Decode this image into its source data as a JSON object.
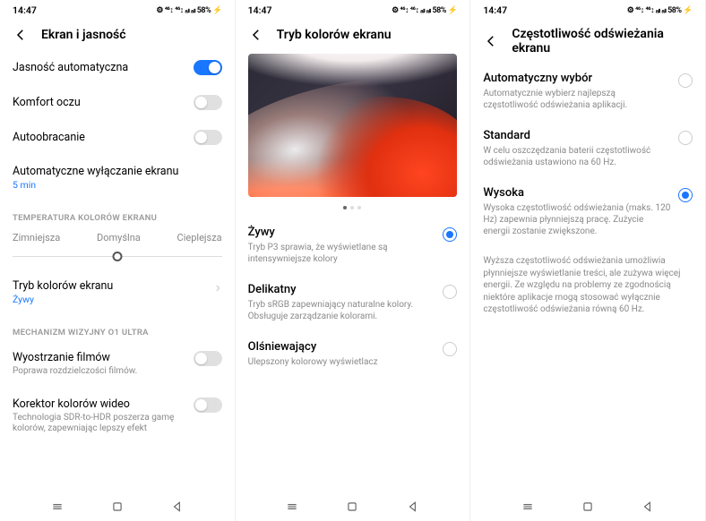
{
  "status": {
    "time": "14:47",
    "icons": "⚙ ⁴⁶↕ ⁴⁶↕ ₐₗₗ ₐₗₗ 58% ⚡"
  },
  "s1": {
    "title": "Ekran i jasność",
    "auto_brightness": "Jasność automatyczna",
    "eye_comfort": "Komfort oczu",
    "auto_rotate": "Autoobracanie",
    "screen_off": "Automatyczne wyłączanie ekranu",
    "screen_off_val": "5 min",
    "temp_header": "TEMPERATURA KOLORÓW EKRANU",
    "temp_cold": "Zimniejsza",
    "temp_default": "Domyślna",
    "temp_warm": "Cieplejsza",
    "color_mode": "Tryb kolorów ekranu",
    "color_mode_val": "Żywy",
    "o1_header": "MECHANIZM WIZYJNY O1 ULTRA",
    "sharpen": "Wyostrzanie filmów",
    "sharpen_sub": "Poprawa rozdzielczości filmów.",
    "color_correct": "Korektor kolorów wideo",
    "color_correct_sub": "Technologia SDR-to-HDR poszerza gamę kolorów, zapewniając lepszy efekt"
  },
  "s2": {
    "title": "Tryb kolorów ekranu",
    "vivid": "Żywy",
    "vivid_sub": "Tryb P3 sprawia, że wyświetlane są intensywniejsze kolory",
    "gentle": "Delikatny",
    "gentle_sub": "Tryb sRGB zapewniający naturalne kolory. Obsługuje zarządzanie kolorami.",
    "dazzling": "Olśniewający",
    "dazzling_sub": "Ulepszony kolorowy wyświetlacz"
  },
  "s3": {
    "title": "Częstotliwość odświeżania ekranu",
    "auto": "Automatyczny wybór",
    "auto_sub": "Automatycznie wybierz najlepszą częstotliwość odświeżania aplikacji.",
    "standard": "Standard",
    "standard_sub": "W celu oszczędzania baterii częstotliwość odświeżania ustawiono na 60 Hz.",
    "high": "Wysoka",
    "high_sub": "Wysoka częstotliwość odświeżania (maks. 120 Hz) zapewnia płynniejszą pracę. Zużycie energii zostanie zwiększone.",
    "note": "Wyższa częstotliwość odświeżania umożliwia płynniejsze wyświetlanie treści, ale zużywa więcej energii. Ze względu na problemy ze zgodnością niektóre aplikacje mogą stosować wyłącznie częstotliwość odświeżania równą 60 Hz."
  }
}
